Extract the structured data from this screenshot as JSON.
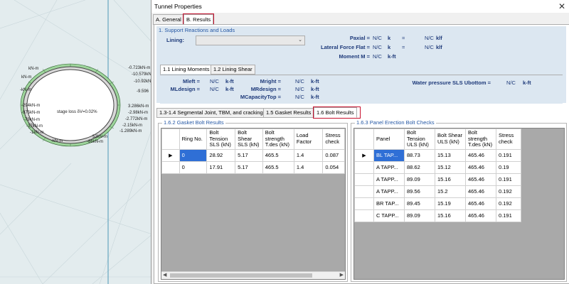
{
  "window": {
    "title": "Tunnel Properties",
    "close_glyph": "✕"
  },
  "main_tabs": [
    {
      "label": "A. General",
      "active": false
    },
    {
      "label": "B. Results",
      "active": true
    }
  ],
  "support": {
    "group_title": "1. Support Reactions and Loads",
    "lining_label": "Lining:",
    "lining_value": "",
    "paxial": {
      "label": "Paxial =",
      "value": "N/C",
      "unit": "k",
      "eq": "=",
      "value2": "N/C",
      "unit2": "klf"
    },
    "lateral": {
      "label": "Lateral Force Flat =",
      "value": "N/C",
      "unit": "k",
      "eq": "=",
      "value2": "N/C",
      "unit2": "klf"
    },
    "moment_m": {
      "label": "Moment M =",
      "value": "N/C",
      "unit": "k-ft"
    }
  },
  "sub_tabs": [
    {
      "label": "1.1 Lining Moments",
      "active": true
    },
    {
      "label": "1.2 Lining Shear",
      "active": false
    }
  ],
  "moments": {
    "mleft": {
      "label": "Mleft =",
      "value": "N/C",
      "unit": "k-ft"
    },
    "mldesign": {
      "label": "MLdesign =",
      "value": "N/C",
      "unit": "k-ft"
    },
    "mright": {
      "label": "Mright =",
      "value": "N/C",
      "unit": "k-ft"
    },
    "mrdesign": {
      "label": "MRdesign =",
      "value": "N/C",
      "unit": "k-ft"
    },
    "mcapacity": {
      "label": "MCapacityTop =",
      "value": "N/C",
      "unit": "k-ft"
    },
    "water": {
      "label": "Water pressure SLS Ubottom =",
      "value": "N/C",
      "unit": "k-ft"
    }
  },
  "bolt_tabs": [
    {
      "label": "1.3-1.4 Segmental Joint, TBM, and cracking",
      "active": false
    },
    {
      "label": "1.5 Gasket Results",
      "active": false
    },
    {
      "label": "1.6 Bolt Results",
      "active": true
    }
  ],
  "gasket": {
    "title": "1.6.2 Gasket Bolt Results",
    "columns": [
      "Ring No.",
      "Bolt Tension SLS (kN)",
      "Bolt Shear SLS (kN)",
      "Bolt strength T.des (kN)",
      "Load Factor",
      "Stress check"
    ],
    "rows": [
      [
        "0",
        "28.92",
        "5.17",
        "465.5",
        "1.4",
        "0.087"
      ],
      [
        "0",
        "17.91",
        "5.17",
        "465.5",
        "1.4",
        "0.054"
      ]
    ],
    "scroll_left": "◀",
    "scroll_right": "▶"
  },
  "panel": {
    "title": "1.6.3 Panel Erection Bolt Checks",
    "columns": [
      "Panel",
      "Bolt Tension ULS (kN)",
      "Bolt Shear ULS (kN)",
      "Bolt strength T.des (kN)",
      "Stress check"
    ],
    "rows": [
      [
        "BL TAP...",
        "88.73",
        "15.13",
        "465.46",
        "0.191"
      ],
      [
        "A TAPP...",
        "88.62",
        "15.12",
        "465.46",
        "0.19"
      ],
      [
        "A TAPP...",
        "89.09",
        "15.16",
        "465.46",
        "0.191"
      ],
      [
        "A TAPP...",
        "89.56",
        "15.2",
        "465.46",
        "0.192"
      ],
      [
        "BR TAP...",
        "89.45",
        "15.19",
        "465.46",
        "0.192"
      ],
      [
        "C TAPP...",
        "89.09",
        "15.16",
        "465.46",
        "0.191"
      ]
    ]
  },
  "current_row_glyph": "▶",
  "drawing": {
    "stage_label": "stage loss δV=0.02%",
    "moment_labels": [
      "3.286kN-m",
      "-2.98kN-m",
      "-2.772kN-m",
      "-2.15kN-m",
      "-1.289kN-m",
      "-0.723kN-m",
      "-10.579kN",
      "-10.92kN",
      "-9.596",
      "-294kN-m",
      "-975kN-m",
      "-79kN-m",
      "-37kN-m",
      "-1kN-m",
      "kN-m",
      "kN-m",
      "-kN-m",
      "52kN-m",
      "-86kN-m",
      "-kN-m"
    ]
  }
}
